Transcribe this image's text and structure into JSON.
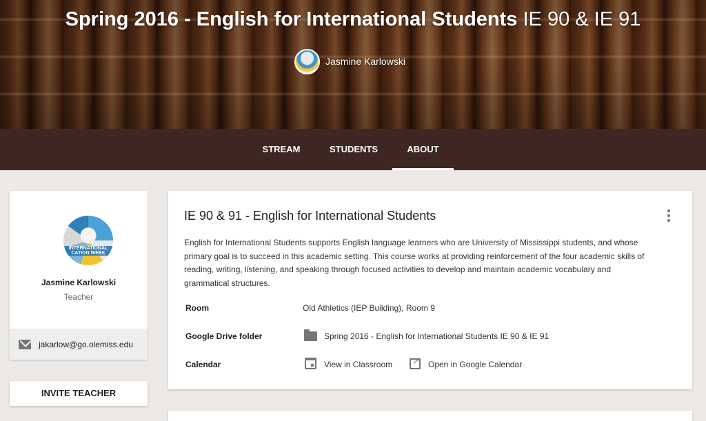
{
  "header": {
    "title_main": "Spring 2016 - English for International Students",
    "title_codes": "IE 90 & IE 91",
    "owner_name": "Jasmine Karlowski"
  },
  "nav": {
    "tabs": [
      {
        "label": "STREAM"
      },
      {
        "label": "STUDENTS"
      },
      {
        "label": "ABOUT",
        "active": true
      }
    ]
  },
  "teacher": {
    "avatar_text": "INTERNATIONAL CATION WEEK",
    "name": "Jasmine Karlowski",
    "role": "Teacher",
    "email": "jakarlow@go.olemiss.edu",
    "invite_label": "INVITE TEACHER"
  },
  "about": {
    "title": "IE 90 & 91 - English for International Students",
    "description": "English for International Students supports English language learners who are University of Mississippi students, and whose primary goal is to succeed in this academic setting. This course works at providing reinforcement of the four academic skills of reading, writing, listening, and speaking through focused activities to develop and maintain academic vocabulary and grammatical structures.",
    "room_label": "Room",
    "room_value": "Old Athletics (IEP Building), Room 9",
    "drive_label": "Google Drive folder",
    "drive_value": "Spring 2016 - English for International Students IE 90 & IE 91",
    "calendar_label": "Calendar",
    "calendar_classroom": "View in Classroom",
    "calendar_google": "Open in Google Calendar"
  },
  "colors": {
    "nav_bg": "#3e2723",
    "page_bg": "#ece9e6"
  },
  "icons": {
    "mail": "mail-icon",
    "folder": "folder-icon",
    "calendar": "calendar-icon",
    "external": "open-in-new-icon",
    "more": "more-vert-icon"
  }
}
